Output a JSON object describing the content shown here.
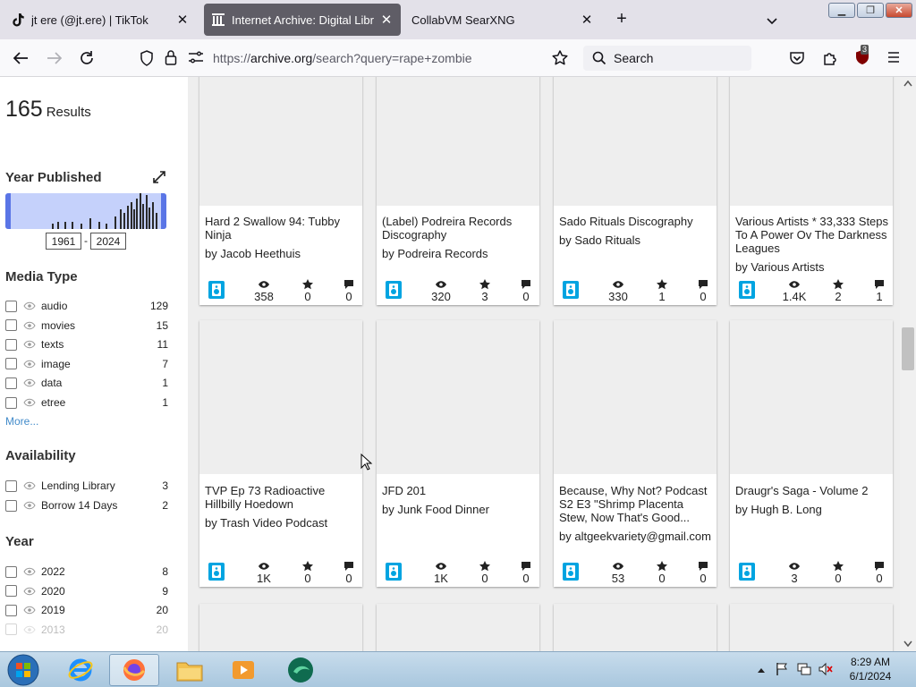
{
  "browser": {
    "tabs": [
      {
        "title": "jt ere (@jt.ere) | TikTok",
        "active": false,
        "icon": "tiktok-icon"
      },
      {
        "title": "Internet Archive: Digital Library",
        "active": true,
        "icon": "archive-icon"
      },
      {
        "title": "CollabVM SearXNG",
        "active": false,
        "icon": ""
      }
    ],
    "url": "https://archive.org/search?query=rape+zombie",
    "url_prefix": "https://",
    "url_host": "archive.org",
    "url_path": "/search?query=rape+zombie",
    "search_placeholder": "Search",
    "extension_badge": "3"
  },
  "sidebar": {
    "results_count": "165",
    "results_label": "Results",
    "year_published": {
      "title": "Year Published",
      "from": "1961",
      "to": "2024",
      "separator": "-"
    },
    "media_type": {
      "title": "Media Type",
      "items": [
        {
          "label": "audio",
          "count": "129"
        },
        {
          "label": "movies",
          "count": "15"
        },
        {
          "label": "texts",
          "count": "11"
        },
        {
          "label": "image",
          "count": "7"
        },
        {
          "label": "data",
          "count": "1"
        },
        {
          "label": "etree",
          "count": "1"
        }
      ],
      "more": "More..."
    },
    "availability": {
      "title": "Availability",
      "items": [
        {
          "label": "Lending Library",
          "count": "3"
        },
        {
          "label": "Borrow 14 Days",
          "count": "2"
        }
      ]
    },
    "year": {
      "title": "Year",
      "items": [
        {
          "label": "2022",
          "count": "8"
        },
        {
          "label": "2020",
          "count": "9"
        },
        {
          "label": "2019",
          "count": "20"
        },
        {
          "label": "2013",
          "count": "20"
        }
      ]
    }
  },
  "results": [
    {
      "title": "Hard 2 Swallow 94: Tubby Ninja",
      "by": "by Jacob Heethuis",
      "views": "358",
      "favs": "0",
      "reviews": "0"
    },
    {
      "title": "(Label) Podreira Records Discography",
      "by": "by Podreira Records",
      "views": "320",
      "favs": "3",
      "reviews": "0"
    },
    {
      "title": "Sado Rituals Discography",
      "by": "by Sado Rituals",
      "views": "330",
      "favs": "1",
      "reviews": "0"
    },
    {
      "title": "Various Artists * 33,333 Steps To A Power Ov The Darkness Leagues",
      "by": "by Various Artists",
      "views": "1.4K",
      "favs": "2",
      "reviews": "1"
    },
    {
      "title": "TVP Ep 73 Radioactive Hillbilly Hoedown",
      "by": "by Trash Video Podcast",
      "views": "1K",
      "favs": "0",
      "reviews": "0"
    },
    {
      "title": "JFD 201",
      "by": "by Junk Food Dinner",
      "views": "1K",
      "favs": "0",
      "reviews": "0"
    },
    {
      "title": "Because, Why Not? Podcast S2 E3 \"Shrimp Placenta Stew, Now That's Good...",
      "by": "by altgeekvariety@gmail.com",
      "views": "53",
      "favs": "0",
      "reviews": "0"
    },
    {
      "title": "Draugr's Saga - Volume 2",
      "by": "by Hugh B. Long",
      "views": "3",
      "favs": "0",
      "reviews": "0"
    }
  ],
  "taskbar": {
    "time": "8:29 AM",
    "date": "6/1/2024"
  }
}
